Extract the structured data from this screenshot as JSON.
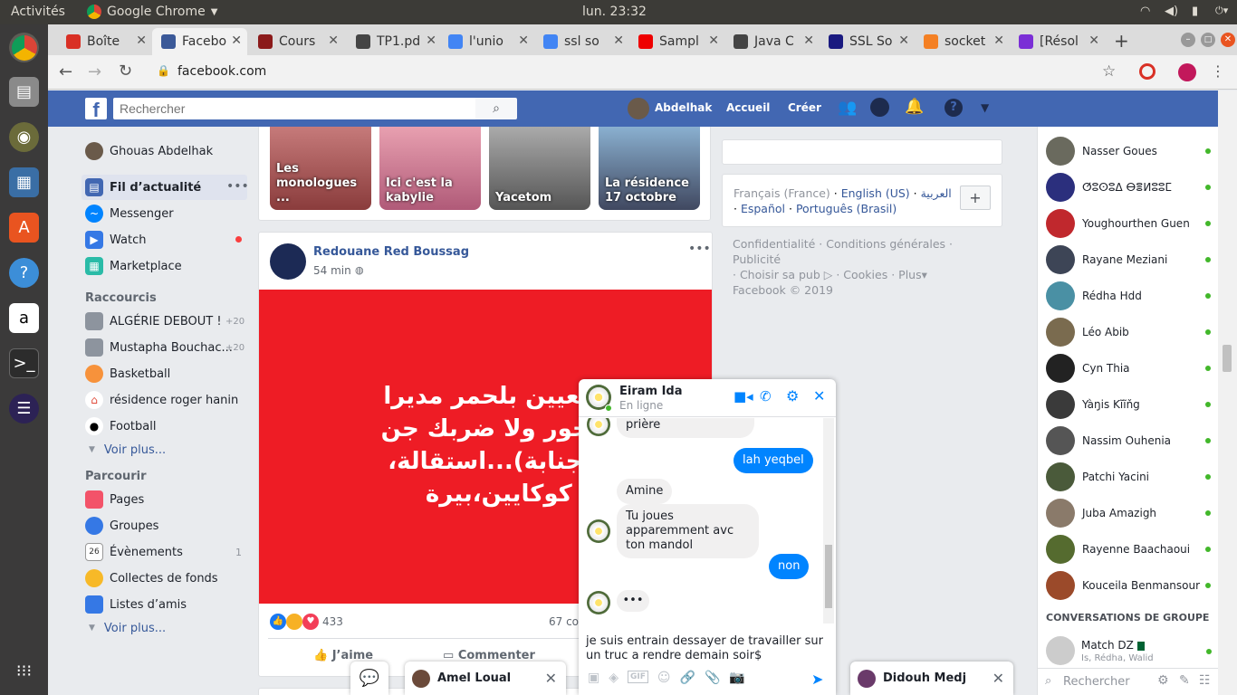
{
  "ubuntu": {
    "activities": "Activités",
    "app": "Google Chrome",
    "clock": "lun. 23:32"
  },
  "tabs": [
    {
      "label": "Boîte",
      "icon": "gmail-icon",
      "color": "#d93025"
    },
    {
      "label": "Facebo",
      "icon": "facebook-icon",
      "color": "#3b5998"
    },
    {
      "label": "Cours",
      "icon": "cours-icon",
      "color": "#8b1a1a"
    },
    {
      "label": "TP1.pd",
      "icon": "pdf-icon",
      "color": "#444444"
    },
    {
      "label": "l'unio",
      "icon": "google-icon",
      "color": "#4285f4"
    },
    {
      "label": "ssl so",
      "icon": "google-icon",
      "color": "#4285f4"
    },
    {
      "label": "Sampl",
      "icon": "oracle-icon",
      "color": "#e00"
    },
    {
      "label": "Java C",
      "icon": "java-icon",
      "color": "#444444"
    },
    {
      "label": "SSL So",
      "icon": "ssl-icon",
      "color": "#1a1a80"
    },
    {
      "label": "socket",
      "icon": "stackoverflow-icon",
      "color": "#f48024"
    },
    {
      "label": "[Résol",
      "icon": "resolu-icon",
      "color": "#7b2fd6"
    }
  ],
  "address": {
    "url": "facebook.com"
  },
  "fb": {
    "search_placeholder": "Rechercher",
    "profile": "Abdelhak",
    "home": "Accueil",
    "create": "Créer",
    "left": {
      "user": "Ghouas Abdelhak",
      "items": [
        {
          "label": "Fil d’actualité"
        },
        {
          "label": "Messenger"
        },
        {
          "label": "Watch"
        },
        {
          "label": "Marketplace"
        }
      ],
      "shortcuts_title": "Raccourcis",
      "shortcuts": [
        {
          "label": "ALGÉRIE DEBOUT !",
          "count": "+20"
        },
        {
          "label": "Mustapha Bouchac...",
          "count": "+20"
        },
        {
          "label": "Basketball",
          "count": ""
        },
        {
          "label": "résidence roger hanin",
          "count": ""
        },
        {
          "label": "Football",
          "count": ""
        }
      ],
      "see_more": "Voir plus...",
      "explore_title": "Parcourir",
      "explore": [
        {
          "label": "Pages",
          "count": ""
        },
        {
          "label": "Groupes",
          "count": ""
        },
        {
          "label": "Évènements",
          "count": "1"
        },
        {
          "label": "Collectes de fonds",
          "count": ""
        },
        {
          "label": "Listes d’amis",
          "count": ""
        }
      ],
      "see_more2": "Voir plus..."
    },
    "stories": [
      "Les monologues ...",
      "Ici c'est la kabylie",
      "Yacetom",
      "La résidence 17 octobre"
    ],
    "post": {
      "author": "Redouane Red Boussag",
      "time": "54 min",
      "image_text": [
        "ى تبون تعيين بلحمر مديرا",
        "راك مسحور ولا ضربك جن",
        "ا تدوش(جنابة)...استقالة،",
        "ن،مرض، كوكايين،بيرة"
      ],
      "reactions": "433",
      "comments": "67 co",
      "like": "J’aime",
      "comment": "Commenter"
    },
    "languages": {
      "current": "Français (France)",
      "others": [
        "English (US)",
        "العربية",
        "Español",
        "Português (Brasil)"
      ]
    },
    "footer": {
      "links": [
        "Confidentialité",
        "Conditions générales",
        "Publicité",
        "Choisir sa pub",
        "Cookies",
        "Plus"
      ],
      "copyright": "Facebook © 2019"
    }
  },
  "contacts": [
    {
      "name": "Nasser Goues",
      "color": "#6a6a5e"
    },
    {
      "name": "ⵚⵓⵙⵓⵠ ⴱⴻⵍⵓⵓⵎ",
      "color": "#2b2f7d"
    },
    {
      "name": "Youghourthen Guen",
      "color": "#c0282d"
    },
    {
      "name": "Rayane Meziani",
      "color": "#3d4556"
    },
    {
      "name": "Rédha Hdd",
      "color": "#4a90a4"
    },
    {
      "name": "Léo Abib",
      "color": "#7a6b4f"
    },
    {
      "name": "Cyn Thia",
      "color": "#222222"
    },
    {
      "name": "Yàŋis Kĩĩňg",
      "color": "#3a3a3a"
    },
    {
      "name": "Nassim Ouhenia",
      "color": "#555555"
    },
    {
      "name": "Patchi Yacini",
      "color": "#4a5a3a"
    },
    {
      "name": "Juba Amazigh",
      "color": "#8a7a6a"
    },
    {
      "name": "Rayenne Baachaoui",
      "color": "#556b2f"
    },
    {
      "name": "Kouceila Benmansour",
      "color": "#9b4a2a"
    }
  ],
  "group_title": "CONVERSATIONS DE GROUPE",
  "group": {
    "name": "Match DZ",
    "members": "Is, Rédha, Walid"
  },
  "side_search": "Rechercher",
  "chat": {
    "name": "Eiram Ida",
    "status": "En ligne",
    "messages": [
      {
        "who": "in",
        "text": "prière"
      },
      {
        "who": "out",
        "text": "lah yeqbel"
      },
      {
        "who": "in",
        "text": "Amine"
      },
      {
        "who": "in",
        "text": "Tu joues apparemment avc ton mandol"
      },
      {
        "who": "out",
        "text": "non"
      }
    ],
    "draft": "je suis entrain dessayer de travailler sur un truc a rendre demain soir$"
  },
  "dock": {
    "left": "Amel Loual",
    "right": "Didouh Medj"
  }
}
